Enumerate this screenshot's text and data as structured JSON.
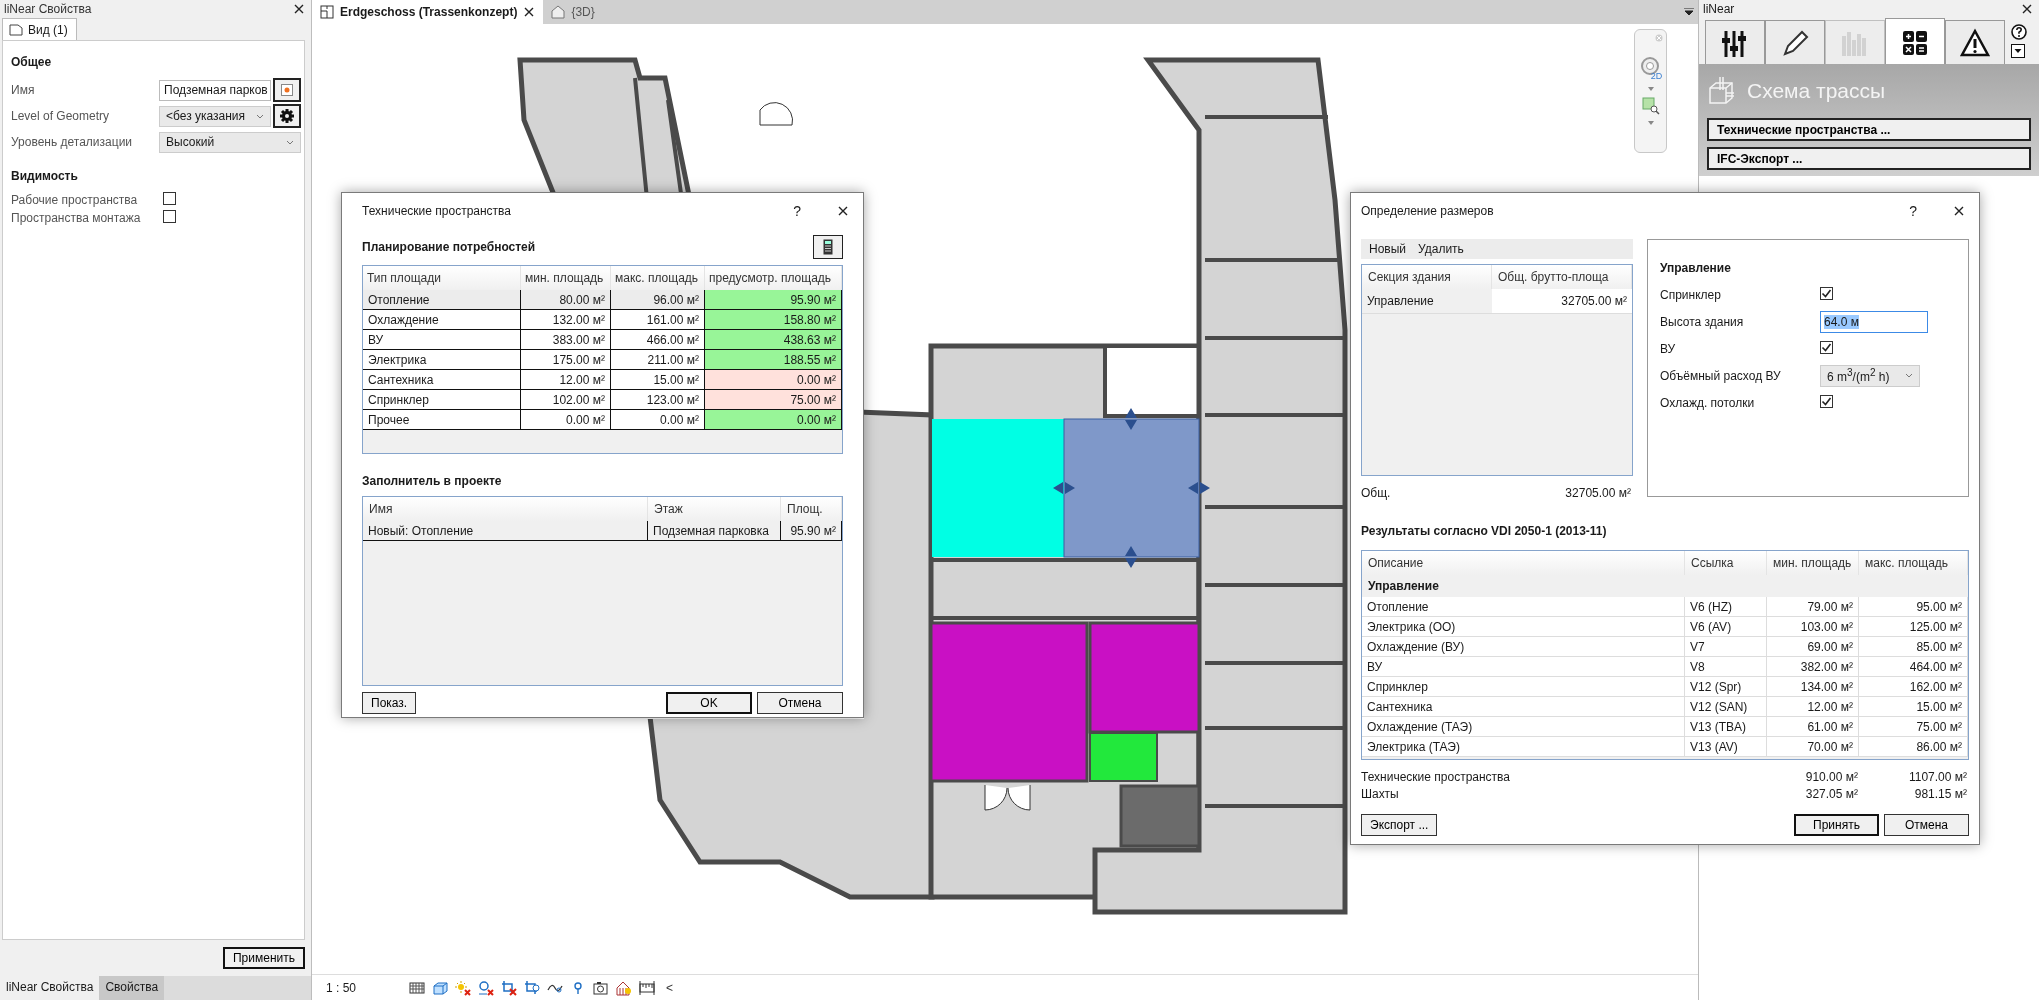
{
  "left_panel": {
    "title": "liNear Свойства",
    "tab": "Вид (1)",
    "sections": [
      {
        "heading": "Общее",
        "rows": [
          {
            "kind": "text",
            "label": "Имя",
            "value": "Подземная парков",
            "button": {
              "kind": "pick"
            }
          },
          {
            "kind": "dropdown",
            "label": "Level of Geometry",
            "value": "<без указания",
            "button": {
              "kind": "settings"
            }
          },
          {
            "kind": "dropdown",
            "label": "Уровень детализации",
            "value": "Высокий"
          }
        ]
      },
      {
        "heading": "Видимость",
        "rows": [
          {
            "kind": "checkbox",
            "label": "Рабочие пространства",
            "checked": false
          },
          {
            "kind": "checkbox",
            "label": "Пространства монтажа",
            "checked": false
          }
        ]
      }
    ],
    "apply_button": "Применить",
    "bottom_tabs": [
      {
        "label": "liNear Свойства",
        "selected": true
      },
      {
        "label": "Свойства",
        "selected": false
      }
    ]
  },
  "view": {
    "tabs": [
      {
        "label": "Erdgeschoss (Trassenkonzept)",
        "selected": true,
        "kind": "plan"
      },
      {
        "label": "{3D}",
        "selected": false,
        "kind": "model"
      }
    ],
    "nav_wheel_label": "2D",
    "scale": "1 : 50",
    "collapse_glyph": "<"
  },
  "right_panel": {
    "title": "liNear",
    "tabs": [
      {
        "kind": "sliders",
        "selected": false,
        "disabled": false
      },
      {
        "kind": "pencil",
        "selected": false,
        "disabled": false
      },
      {
        "kind": "bars",
        "selected": false,
        "disabled": true
      },
      {
        "kind": "calculator",
        "selected": true,
        "disabled": false
      },
      {
        "kind": "warning",
        "selected": false,
        "disabled": false
      }
    ],
    "section_title": "Схема трассы",
    "buttons": [
      "Технические пространства ...",
      "IFC-Экспорт ..."
    ]
  },
  "tech_dialog": {
    "title": "Технические пространства",
    "help": "?",
    "requirements": {
      "heading": "Планирование потребностей",
      "columns": [
        "Тип площади",
        "мин. площадь",
        "макс. площадь",
        "предусмотр. площадь"
      ],
      "rows": [
        {
          "type": "Отопление",
          "min": "80.00 м²",
          "max": "96.00 м²",
          "planned": "95.90 м²",
          "color": "#98f598",
          "selected": true
        },
        {
          "type": "Охлаждение",
          "min": "132.00 м²",
          "max": "161.00 м²",
          "planned": "158.80 м²",
          "color": "#98f598",
          "selected": false
        },
        {
          "type": "ВУ",
          "min": "383.00 м²",
          "max": "466.00 м²",
          "planned": "438.63 м²",
          "color": "#98f598",
          "selected": false
        },
        {
          "type": "Электрика",
          "min": "175.00 м²",
          "max": "211.00 м²",
          "planned": "188.55 м²",
          "color": "#98f598",
          "selected": false
        },
        {
          "type": "Сантехника",
          "min": "12.00 м²",
          "max": "15.00 м²",
          "planned": "0.00 м²",
          "color": "#ffe1dc",
          "selected": false
        },
        {
          "type": "Спринклер",
          "min": "102.00 м²",
          "max": "123.00 м²",
          "planned": "75.00 м²",
          "color": "#ffe1dc",
          "selected": false
        },
        {
          "type": "Прочее",
          "min": "0.00 м²",
          "max": "0.00 м²",
          "planned": "0.00 м²",
          "color": "#98f598",
          "selected": false
        }
      ]
    },
    "placeholders": {
      "heading": "Заполнитель в проекте",
      "columns": [
        "Имя",
        "Этаж",
        "Площ."
      ],
      "rows": [
        {
          "name": "Новый: Отопление",
          "floor": "Подземная парковка",
          "area": "95.90 м²"
        }
      ]
    },
    "buttons": {
      "show": "Показ.",
      "ok": "OK",
      "cancel": "Отмена"
    }
  },
  "sizing_dialog": {
    "title": "Определение размеров",
    "help": "?",
    "toolbar": [
      "Новый",
      "Удалить"
    ],
    "sections": {
      "columns": [
        "Секция здания",
        "Общ. брутто-площа"
      ],
      "rows": [
        {
          "name": "Управление",
          "area": "32705.00 м²"
        }
      ]
    },
    "total": {
      "label": "Общ.",
      "value": "32705.00 м²"
    },
    "settings": {
      "heading": "Управление",
      "rows": [
        {
          "kind": "checkbox",
          "label": "Спринклер",
          "checked": true
        },
        {
          "kind": "input",
          "label": "Высота здания",
          "value": "64.0 м"
        },
        {
          "kind": "checkbox",
          "label": "ВУ",
          "checked": true
        },
        {
          "kind": "dropdown",
          "label": "Объёмный расход ВУ",
          "value": "6 m$^{3}$/(m$^{2}$ h)"
        },
        {
          "kind": "checkbox",
          "label": "Охлажд. потолки",
          "checked": true
        }
      ]
    },
    "results": {
      "heading": "Результаты согласно VDI 2050-1 (2013-11)",
      "columns": [
        "Описание",
        "Ссылка",
        "мин. площадь",
        "макс. площадь"
      ],
      "rows": [
        {
          "kind": "group",
          "label": "Управление"
        },
        {
          "kind": "item",
          "label": "Отопление",
          "ref": "V6 (HZ)",
          "min": "79.00 м²",
          "max": "95.00 м²"
        },
        {
          "kind": "item",
          "label": "Электрика (ОО)",
          "ref": "V6 (AV)",
          "min": "103.00 м²",
          "max": "125.00 м²"
        },
        {
          "kind": "item",
          "label": "Охлаждение (ВУ)",
          "ref": "V7",
          "min": "69.00 м²",
          "max": "85.00 м²"
        },
        {
          "kind": "item",
          "label": "ВУ",
          "ref": "V8",
          "min": "382.00 м²",
          "max": "464.00 м²"
        },
        {
          "kind": "item",
          "label": "Спринклер",
          "ref": "V12 (Spr)",
          "min": "134.00 м²",
          "max": "162.00 м²"
        },
        {
          "kind": "item",
          "label": "Сантехника",
          "ref": "V12 (SAN)",
          "min": "12.00 м²",
          "max": "15.00 м²"
        },
        {
          "kind": "item",
          "label": "Охлаждение (ТАЭ)",
          "ref": "V13 (TBA)",
          "min": "61.00 м²",
          "max": "75.00 м²"
        },
        {
          "kind": "item",
          "label": "Электрика (ТАЭ)",
          "ref": "V13 (AV)",
          "min": "70.00 м²",
          "max": "86.00 м²"
        }
      ]
    },
    "totals": [
      {
        "label": "Технические пространства",
        "min": "910.00 м²",
        "max": "1107.00 м²"
      },
      {
        "label": "Шахты",
        "min": "327.05 м²",
        "max": "981.15 м²"
      }
    ],
    "buttons": {
      "export": "Экспорт ...",
      "accept": "Принять",
      "cancel": "Отмена"
    }
  }
}
